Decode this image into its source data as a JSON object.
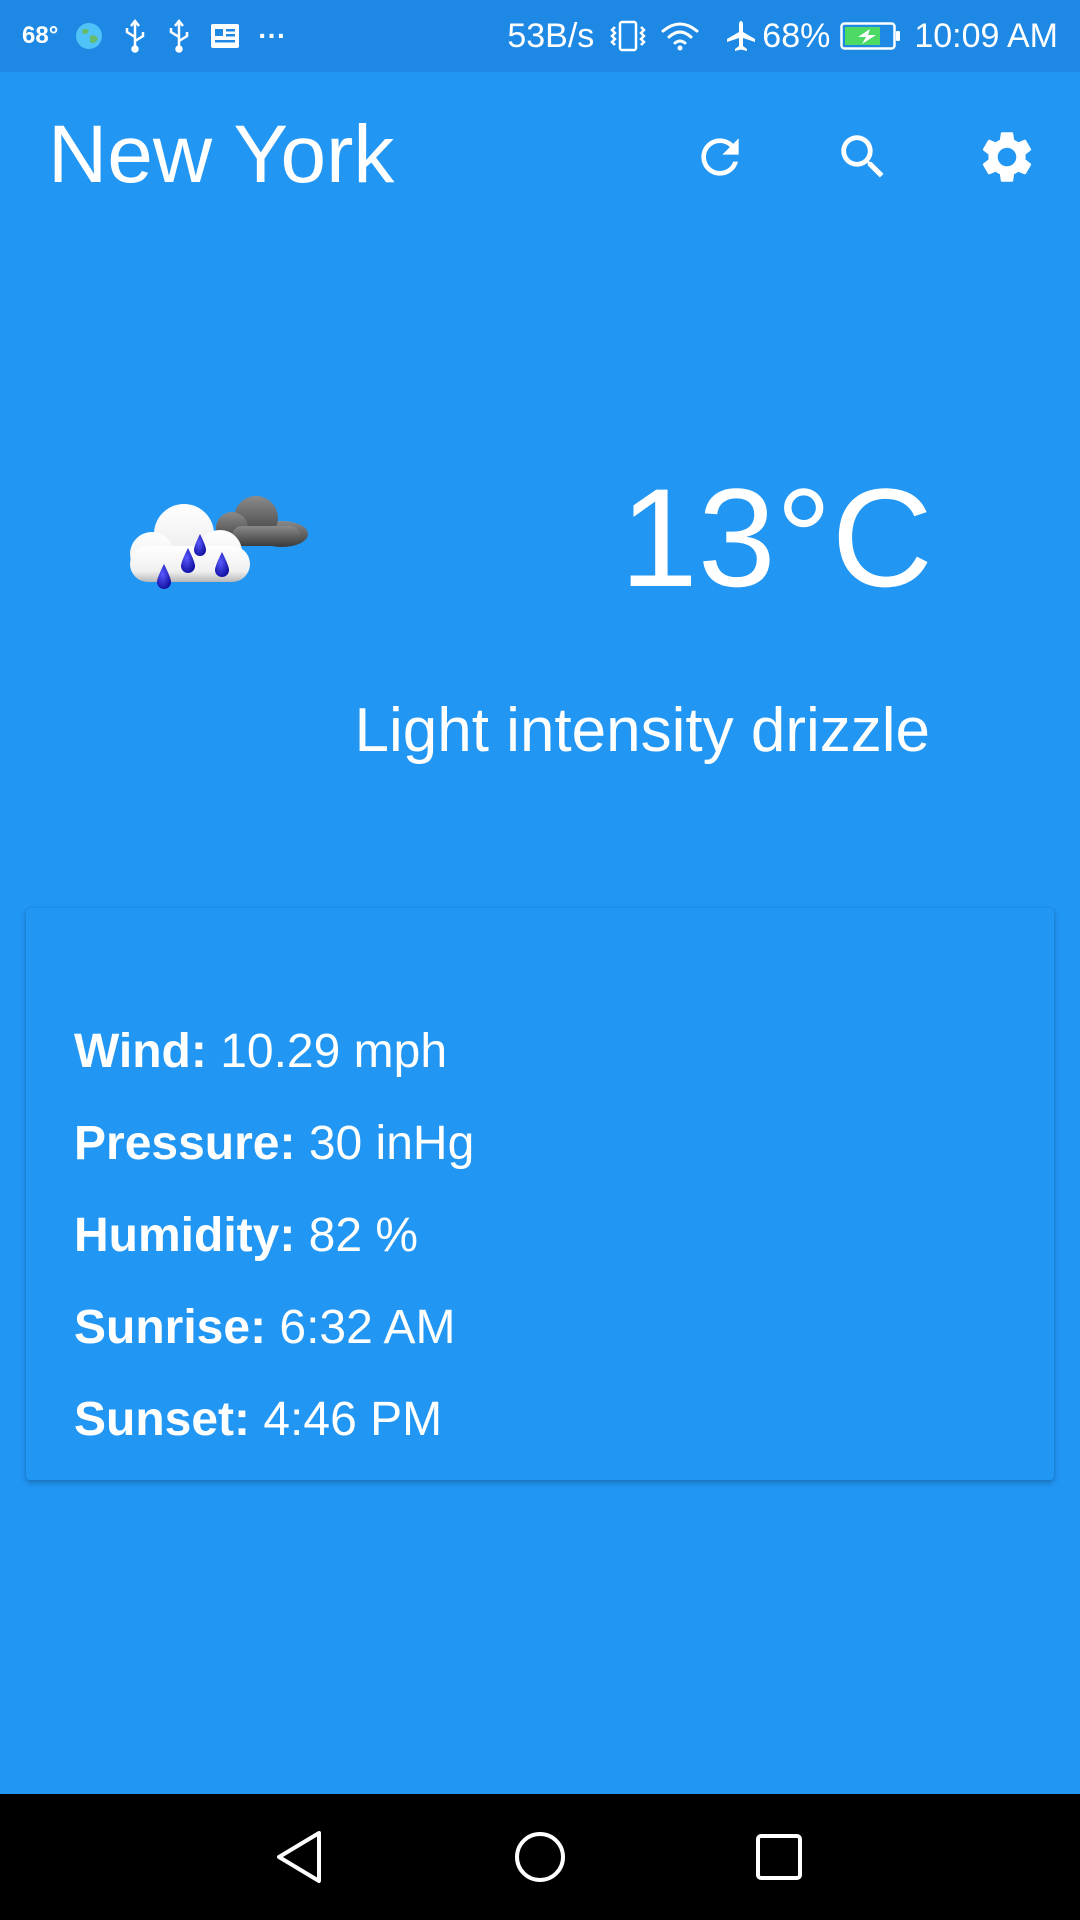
{
  "status_bar": {
    "weather_temp": "68°",
    "more": "···",
    "network_speed": "53B/s",
    "battery_percent": "68%",
    "time": "10:09 AM",
    "icons": [
      "globe-icon",
      "usb-icon",
      "usb-icon",
      "news-icon",
      "vibrate-icon",
      "wifi-icon",
      "airplane-icon",
      "battery-charging-icon"
    ]
  },
  "app_bar": {
    "city": "New York",
    "actions": [
      "refresh-icon",
      "search-icon",
      "settings-icon"
    ]
  },
  "current": {
    "temperature": "13°C",
    "description": "Light intensity drizzle",
    "icon": "rain-cloud-icon"
  },
  "details": {
    "wind_label": "Wind:",
    "wind_value": "10.29 mph",
    "pressure_label": "Pressure:",
    "pressure_value": "30 inHg",
    "humidity_label": "Humidity:",
    "humidity_value": "82 %",
    "sunrise_label": "Sunrise:",
    "sunrise_value": "6:32 AM",
    "sunset_label": "Sunset:",
    "sunset_value": "4:46 PM"
  },
  "nav_bar": {
    "buttons": [
      "back-icon",
      "home-icon",
      "recents-icon"
    ]
  },
  "colors": {
    "background": "#2196F3",
    "status_bar": "#1E88E5",
    "nav_bar": "#000000",
    "text": "#FFFFFF",
    "battery_fill": "#4CD964"
  }
}
